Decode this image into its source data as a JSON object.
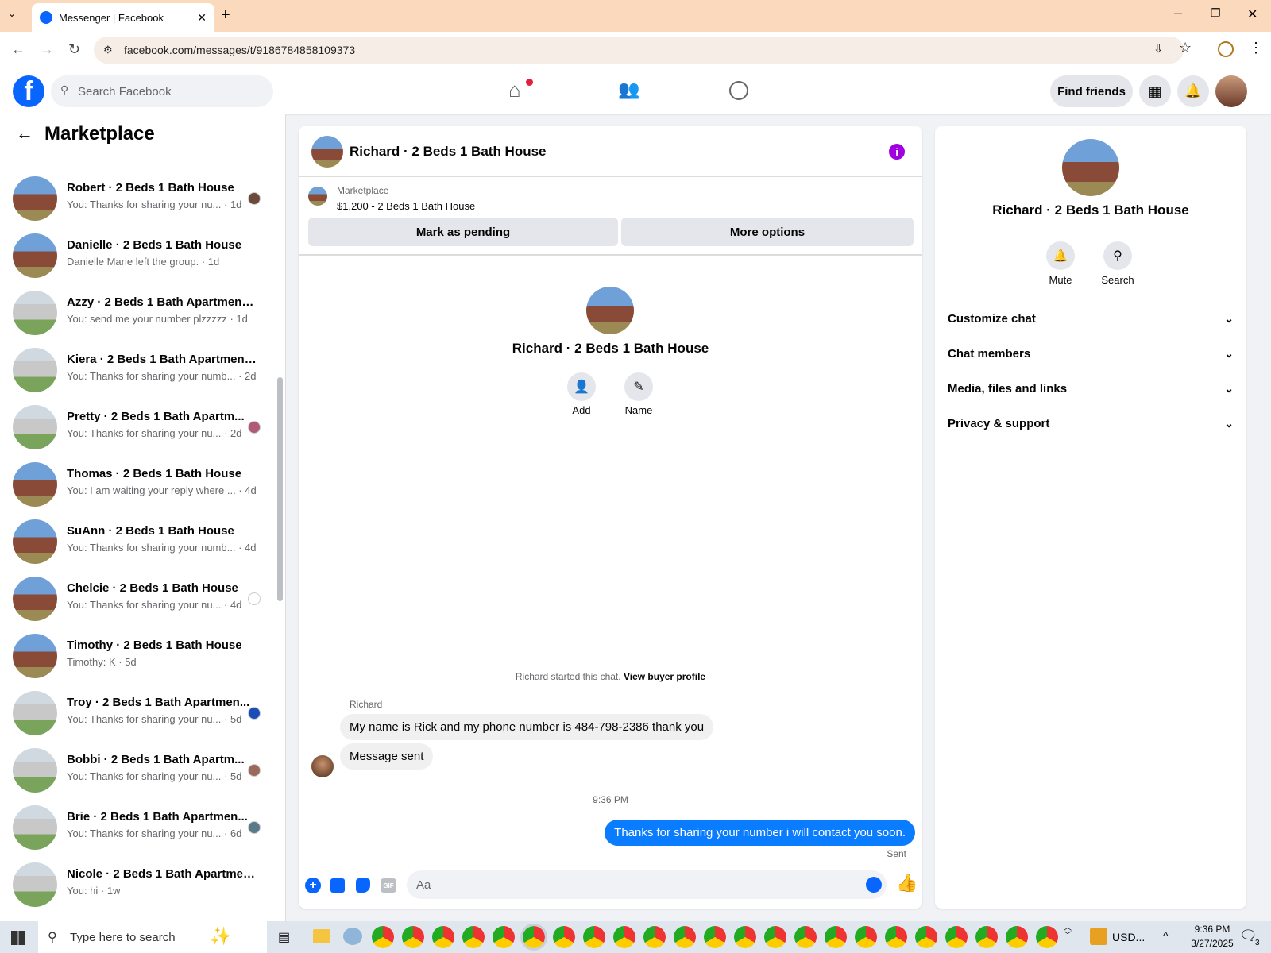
{
  "browser": {
    "tab_title": "Messenger | Facebook",
    "url": "facebook.com/messages/t/9186784858109373"
  },
  "header": {
    "search_placeholder": "Search Facebook",
    "find_friends": "Find friends"
  },
  "left": {
    "title": "Marketplace",
    "conversations": [
      {
        "name": "Robert · 2 Beds 1 Bath House",
        "preview": "You: Thanks for sharing your nu... · 1d",
        "type": "house",
        "mini": "#6b4a3a"
      },
      {
        "name": "Danielle · 2 Beds 1 Bath House",
        "preview": "Danielle Marie left the group. · 1d",
        "type": "house",
        "mini": ""
      },
      {
        "name": "Azzy · 2 Beds 1 Bath Apartment/...",
        "preview": "You: send me your number plzzzzz · 1d",
        "type": "apt",
        "mini": ""
      },
      {
        "name": "Kiera · 2 Beds 1 Bath Apartment/...",
        "preview": "You: Thanks for sharing your numb... · 2d",
        "type": "apt",
        "mini": ""
      },
      {
        "name": "Pretty · 2 Beds 1 Bath Apartm...",
        "preview": "You: Thanks for sharing your nu... · 2d",
        "type": "apt",
        "mini": "#b05a7a"
      },
      {
        "name": "Thomas · 2 Beds 1 Bath House",
        "preview": "You: I am waiting your reply where ... · 4d",
        "type": "house",
        "mini": ""
      },
      {
        "name": "SuAnn · 2 Beds 1 Bath House",
        "preview": "You: Thanks for sharing your numb... · 4d",
        "type": "house",
        "mini": ""
      },
      {
        "name": "Chelcie · 2 Beds 1 Bath House",
        "preview": "You: Thanks for sharing your nu... · 4d",
        "type": "house",
        "mini": "#ffffff"
      },
      {
        "name": "Timothy · 2 Beds 1 Bath House",
        "preview": "Timothy: K · 5d",
        "type": "house",
        "mini": ""
      },
      {
        "name": "Troy · 2 Beds 1 Bath Apartmen...",
        "preview": "You: Thanks for sharing your nu... · 5d",
        "type": "apt",
        "mini": "#1a4db8"
      },
      {
        "name": "Bobbi · 2 Beds 1 Bath Apartm...",
        "preview": "You: Thanks for sharing your nu... · 5d",
        "type": "apt",
        "mini": "#9a6a5a"
      },
      {
        "name": "Brie · 2 Beds 1 Bath Apartmen...",
        "preview": "You: Thanks for sharing your nu... · 6d",
        "type": "apt",
        "mini": "#5a7a8a"
      },
      {
        "name": "Nicole · 2 Beds 1 Bath Apartmen...",
        "preview": "You: hi · 1w",
        "type": "apt",
        "mini": ""
      }
    ]
  },
  "chat": {
    "title": "Richard · 2 Beds 1 Bath House",
    "listing_source": "Marketplace",
    "listing_title": "$1,200 - 2 Beds 1 Bath House",
    "mark_pending": "Mark as pending",
    "more_options": "More options",
    "profile_name": "Richard · 2 Beds 1 Bath House",
    "add_label": "Add",
    "name_label": "Name",
    "started_text": "Richard started this chat.",
    "view_buyer": "View buyer profile",
    "sender_name": "Richard",
    "msg1": "My name is Rick and my phone number is 484-798-2386 thank you",
    "msg2": "Message sent",
    "timestamp": "9:36 PM",
    "my_msg": "Thanks for sharing your number i will contact you soon.",
    "sent_label": "Sent",
    "input_placeholder": "Aa"
  },
  "right": {
    "name": "Richard · 2 Beds 1 Bath House",
    "mute": "Mute",
    "search": "Search",
    "sections": [
      "Customize chat",
      "Chat members",
      "Media, files and links",
      "Privacy & support"
    ]
  },
  "taskbar": {
    "search_placeholder": "Type here to search",
    "currency": "USD...",
    "time": "9:36 PM",
    "date": "3/27/2025",
    "notif_count": "3"
  }
}
